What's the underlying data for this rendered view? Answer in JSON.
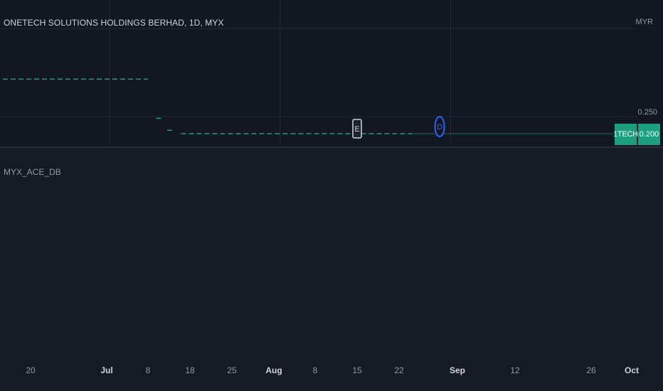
{
  "chart": {
    "title": "ONETECH SOLUTIONS HOLDINGS BERHAD, 1D, MYX",
    "currency": "MYR",
    "price_tick": "0.250",
    "ticker": "1TECH",
    "last_price": "0.200",
    "indicator_pane_label": "MYX_ACE_DB",
    "colors": {
      "background": "#161a25",
      "series": "#1a9e7b",
      "grid": "#222736",
      "earnings_marker": "#d1d4dc",
      "dividend_marker": "#2962ff"
    }
  },
  "chart_data": {
    "type": "line",
    "style": "dashed-step",
    "x_tick_labels": [
      "20",
      "Jul",
      "8",
      "18",
      "25",
      "Aug",
      "8",
      "15",
      "22",
      "Sep",
      "12",
      "26",
      "Oct"
    ],
    "series": [
      {
        "segments": [
          {
            "from": "Jun 11",
            "to": "Jul 8",
            "price": 0.36
          },
          {
            "from": "Jul 10",
            "to": "Jul 10",
            "price": 0.245
          },
          {
            "from": "Jul 12",
            "to": "Jul 12",
            "price": 0.21
          },
          {
            "from": "Jul 14",
            "to": "Aug 25",
            "price": 0.2
          }
        ]
      }
    ],
    "markers": [
      {
        "label": "E",
        "date": "Aug 15",
        "kind": "earnings"
      },
      {
        "label": "D",
        "date": "Aug 30",
        "kind": "dividend"
      }
    ],
    "y_tick_labels": [
      "0.250"
    ],
    "last_value": 0.2,
    "currency": "MYR"
  }
}
